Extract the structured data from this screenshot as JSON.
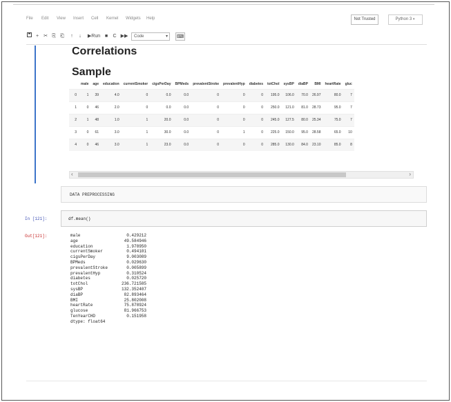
{
  "menubar": {
    "items": [
      "File",
      "Edit",
      "View",
      "Insert",
      "Cell",
      "Kernel",
      "Widgets",
      "Help"
    ],
    "trusted_label": "Not Trusted",
    "kernel_label": "Python 3 ◐"
  },
  "toolbar": {
    "save_icon": "save-icon",
    "plus": "+",
    "cut": "✂",
    "copy": "⎘",
    "paste": "⎗",
    "up": "↑",
    "down": "↓",
    "run_label": "▶Run",
    "stop": "■",
    "restart": "C",
    "fast_forward": "▶▶",
    "cell_type": "Code",
    "keyboard": "⌨"
  },
  "output": {
    "heading_correlations": "Correlations",
    "heading_sample": "Sample",
    "table": {
      "columns": [
        "",
        "male",
        "age",
        "education",
        "currentSmoker",
        "cigsPerDay",
        "BPMeds",
        "prevalentStroke",
        "prevalentHyp",
        "diabetes",
        "totChol",
        "sysBP",
        "diaBP",
        "BMI",
        "heartRate",
        "gluc"
      ],
      "rows": [
        [
          "0",
          "1",
          "39",
          "4.0",
          "0",
          "0.0",
          "0.0",
          "0",
          "0",
          "0",
          "195.0",
          "106.0",
          "70.0",
          "26.97",
          "80.0",
          "7"
        ],
        [
          "1",
          "0",
          "46",
          "2.0",
          "0",
          "0.0",
          "0.0",
          "0",
          "0",
          "0",
          "250.0",
          "121.0",
          "81.0",
          "28.73",
          "95.0",
          "7"
        ],
        [
          "2",
          "1",
          "48",
          "1.0",
          "1",
          "20.0",
          "0.0",
          "0",
          "0",
          "0",
          "245.0",
          "127.5",
          "80.0",
          "25.34",
          "75.0",
          "7"
        ],
        [
          "3",
          "0",
          "61",
          "3.0",
          "1",
          "30.0",
          "0.0",
          "0",
          "1",
          "0",
          "225.0",
          "150.0",
          "95.0",
          "28.58",
          "65.0",
          "10"
        ],
        [
          "4",
          "0",
          "46",
          "3.0",
          "1",
          "23.0",
          "0.0",
          "0",
          "0",
          "0",
          "285.0",
          "130.0",
          "84.0",
          "23.10",
          "85.0",
          "8"
        ]
      ]
    }
  },
  "md_cell": {
    "text": "DATA PREPROCESSING"
  },
  "code_cell": {
    "prompt": "In [121]:",
    "code": "df.mean()"
  },
  "out_cell": {
    "prompt": "Out[121]:",
    "series": [
      {
        "name": "male",
        "value": "0.429212"
      },
      {
        "name": "age",
        "value": "49.584946"
      },
      {
        "name": "education",
        "value": "1.978950"
      },
      {
        "name": "currentSmoker",
        "value": "0.494101"
      },
      {
        "name": "cigsPerDay",
        "value": "9.003089"
      },
      {
        "name": "BPMeds",
        "value": "0.029630"
      },
      {
        "name": "prevalentStroke",
        "value": "0.005899"
      },
      {
        "name": "prevalentHyp",
        "value": "0.310524"
      },
      {
        "name": "diabetes",
        "value": "0.025720"
      },
      {
        "name": "totChol",
        "value": "236.721585"
      },
      {
        "name": "sysBP",
        "value": "132.352407"
      },
      {
        "name": "diaBP",
        "value": "82.893464"
      },
      {
        "name": "BMI",
        "value": "25.802008"
      },
      {
        "name": "heartRate",
        "value": "75.878924"
      },
      {
        "name": "glucose",
        "value": "81.966753"
      },
      {
        "name": "TenYearCHD",
        "value": "0.151958"
      }
    ],
    "dtype": "dtype: float64"
  }
}
